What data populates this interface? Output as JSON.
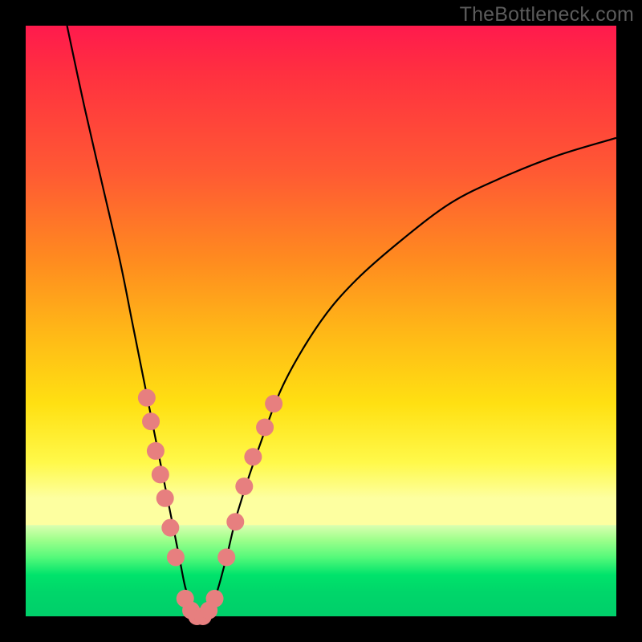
{
  "watermark": "TheBottleneck.com",
  "chart_data": {
    "type": "line",
    "title": "",
    "xlabel": "",
    "ylabel": "",
    "xlim": [
      0,
      100
    ],
    "ylim": [
      0,
      100
    ],
    "series": [
      {
        "name": "bottleneck-curve",
        "x": [
          7,
          10,
          13,
          16,
          18,
          20,
          22,
          24,
          26,
          27,
          28,
          29,
          30,
          32,
          34,
          36,
          40,
          44,
          50,
          56,
          64,
          72,
          80,
          90,
          100
        ],
        "y": [
          100,
          86,
          73,
          60,
          50,
          40,
          30,
          20,
          10,
          5,
          2,
          0,
          0,
          3,
          10,
          18,
          30,
          40,
          50,
          57,
          64,
          70,
          74,
          78,
          81
        ]
      }
    ],
    "points": [
      {
        "name": "left-cluster",
        "coords": [
          {
            "x": 20.5,
            "y": 37
          },
          {
            "x": 21.2,
            "y": 33
          },
          {
            "x": 22.0,
            "y": 28
          },
          {
            "x": 22.8,
            "y": 24
          },
          {
            "x": 23.6,
            "y": 20
          },
          {
            "x": 24.5,
            "y": 15
          },
          {
            "x": 25.4,
            "y": 10
          }
        ]
      },
      {
        "name": "bottom-cluster",
        "coords": [
          {
            "x": 27.0,
            "y": 3
          },
          {
            "x": 28.0,
            "y": 1
          },
          {
            "x": 29.0,
            "y": 0
          },
          {
            "x": 30.0,
            "y": 0
          },
          {
            "x": 31.0,
            "y": 1
          },
          {
            "x": 32.0,
            "y": 3
          }
        ]
      },
      {
        "name": "right-cluster",
        "coords": [
          {
            "x": 34.0,
            "y": 10
          },
          {
            "x": 35.5,
            "y": 16
          },
          {
            "x": 37.0,
            "y": 22
          },
          {
            "x": 38.5,
            "y": 27
          },
          {
            "x": 40.5,
            "y": 32
          },
          {
            "x": 42.0,
            "y": 36
          }
        ]
      }
    ],
    "gradient_bands": [
      {
        "color": "#ff1a4d",
        "stop": 0
      },
      {
        "color": "#ffe012",
        "stop": 64
      },
      {
        "color": "#fdffa0",
        "stop": 83
      },
      {
        "color": "#00cf6a",
        "stop": 100
      }
    ]
  }
}
